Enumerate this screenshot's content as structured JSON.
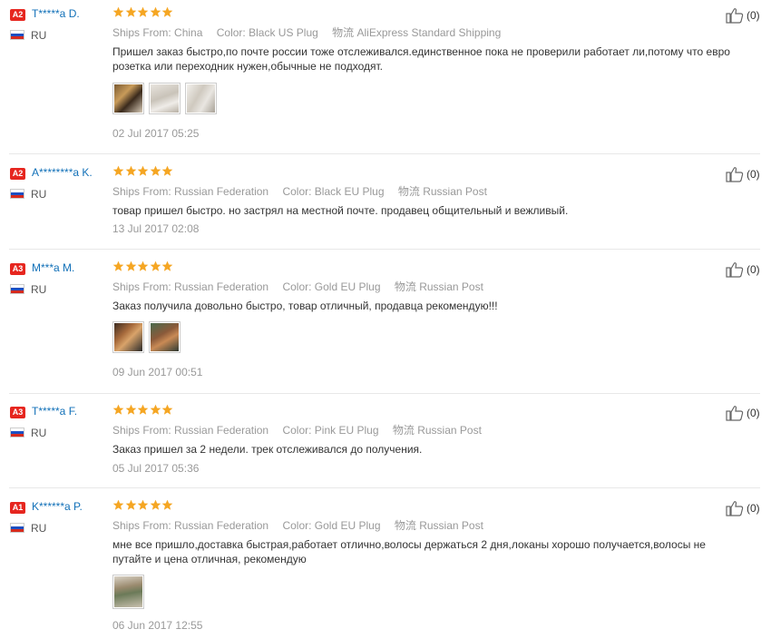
{
  "labels": {
    "ships_from": "Ships From:",
    "color": "Color:",
    "logistics": "物流"
  },
  "reviews": [
    {
      "badge": "A2",
      "name": "T*****a D.",
      "country": "RU",
      "rating": 5,
      "ships_from": "China",
      "color": "Black US Plug",
      "logistics": "AliExpress Standard Shipping",
      "comment": "Пришел заказ быстро,по почте россии тоже отслеживался.единственное пока не проверили работает ли,потому что евро розетка или переходник нужен,обычные не подходят.",
      "photos": 3,
      "date": "02 Jul 2017 05:25",
      "likes": "(0)"
    },
    {
      "badge": "A2",
      "name": "A********a K.",
      "country": "RU",
      "rating": 5,
      "ships_from": "Russian Federation",
      "color": "Black EU Plug",
      "logistics": "Russian Post",
      "comment": "товар пришел быстро. но застрял на местной почте. продавец общительный и вежливый.",
      "photos": 0,
      "date": "13 Jul 2017 02:08",
      "likes": "(0)"
    },
    {
      "badge": "A3",
      "name": "M***a M.",
      "country": "RU",
      "rating": 5,
      "ships_from": "Russian Federation",
      "color": "Gold EU Plug",
      "logistics": "Russian Post",
      "comment": "Заказ получила довольно быстро, товар отличный, продавца рекомендую!!!",
      "photos": 2,
      "date": "09 Jun 2017 00:51",
      "likes": "(0)"
    },
    {
      "badge": "A3",
      "name": "T*****a F.",
      "country": "RU",
      "rating": 5,
      "ships_from": "Russian Federation",
      "color": "Pink EU Plug",
      "logistics": "Russian Post",
      "comment": "Заказ пришел за 2 недели. трек отслеживался до получения.",
      "photos": 0,
      "date": "05 Jul 2017 05:36",
      "likes": "(0)"
    },
    {
      "badge": "A1",
      "name": "K******a P.",
      "country": "RU",
      "rating": 5,
      "ships_from": "Russian Federation",
      "color": "Gold EU Plug",
      "logistics": "Russian Post",
      "comment": "мне все пришло,доставка быстрая,работает отлично,волосы держаться 2 дня,локаны хорошо получается,волосы не путайте и цена отличная, рекомендую",
      "photos": 1,
      "date": "06 Jun 2017 12:55",
      "likes": "(0)"
    }
  ],
  "colors": {
    "badge": "#e6261f",
    "username": "#1170b8",
    "star": "#f5a623",
    "meta_text": "#999999"
  },
  "icons": [
    "thumbs-up-icon",
    "russia-flag-icon",
    "star-icon"
  ]
}
